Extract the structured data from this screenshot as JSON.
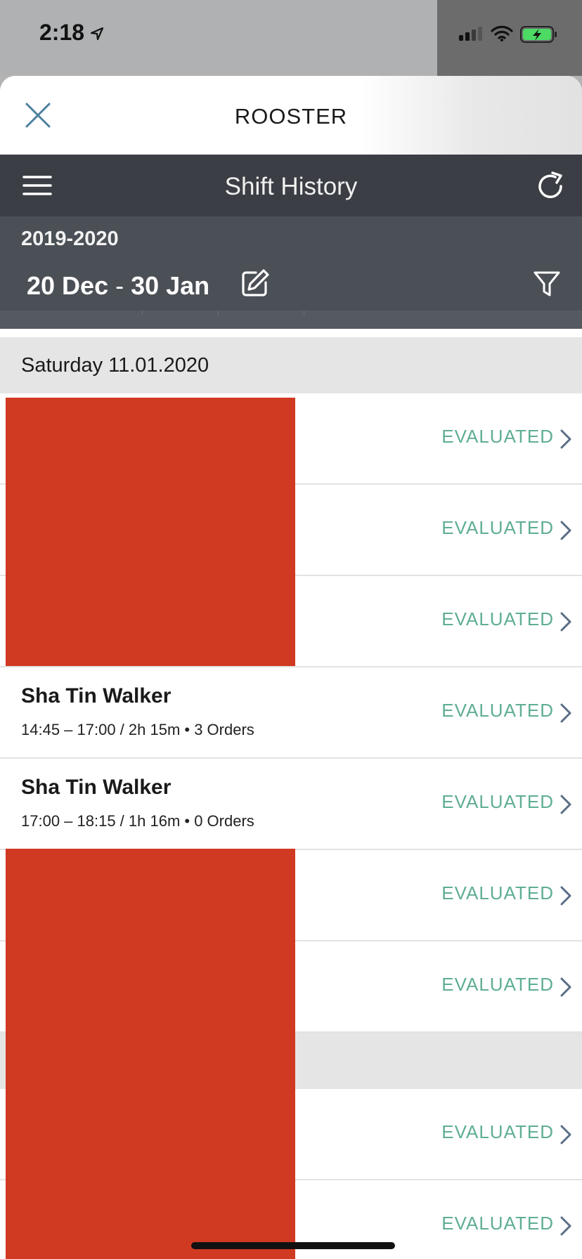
{
  "status_bar": {
    "time": "2:18"
  },
  "sheet": {
    "title": "ROOSTER"
  },
  "nav": {
    "title": "Shift History"
  },
  "period": {
    "season": "2019-2020",
    "range_start": "20 Dec",
    "range_sep": " - ",
    "range_end": "30 Jan"
  },
  "sections": [
    {
      "date": "Saturday 11.01.2020"
    }
  ],
  "shifts": [
    {
      "name": "",
      "detail": "",
      "status": "EVALUATED"
    },
    {
      "name": "",
      "detail": "",
      "status": "EVALUATED"
    },
    {
      "name": "",
      "detail": "",
      "status": "EVALUATED"
    },
    {
      "name": "Sha Tin Walker",
      "detail": "14:45 – 17:00 / 2h 15m • 3 Orders",
      "status": "EVALUATED"
    },
    {
      "name": "Sha Tin Walker",
      "detail": "17:00 – 18:15 / 1h 16m • 0 Orders",
      "status": "EVALUATED"
    },
    {
      "name": "",
      "detail": "",
      "status": "EVALUATED"
    },
    {
      "name": "",
      "detail": "",
      "status": "EVALUATED"
    },
    {
      "name": "",
      "detail": "",
      "status": "EVALUATED"
    },
    {
      "name": "",
      "detail": "",
      "status": "EVALUATED"
    }
  ],
  "icons": {
    "close": "close-icon",
    "menu": "hamburger-menu-icon",
    "refresh": "refresh-icon",
    "edit": "edit-icon",
    "filter": "filter-icon",
    "chevron": "chevron-right-icon"
  },
  "colors": {
    "status_text": "#5fae93",
    "nav_bg": "#3b3e44",
    "period_bg": "#4b4f56",
    "redaction": "#d03a22"
  }
}
